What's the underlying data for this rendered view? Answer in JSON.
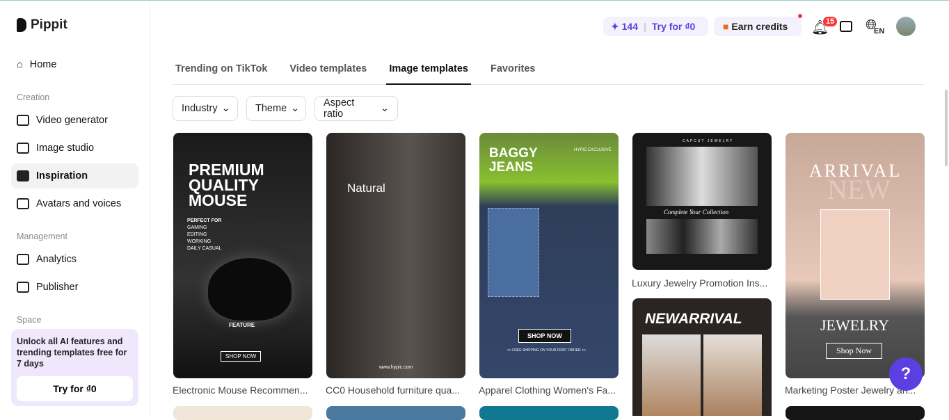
{
  "brand": "Pippit",
  "sidebar": {
    "home": "Home",
    "sections": {
      "creation": "Creation",
      "management": "Management",
      "space": "Space"
    },
    "items": [
      "Video generator",
      "Image studio",
      "Inspiration",
      "Avatars and voices",
      "Analytics",
      "Publisher"
    ],
    "promo": {
      "text": "Unlock all AI features and trending templates free for 7 days",
      "button": "Try for ₫0"
    }
  },
  "header": {
    "credits": "144",
    "try": "Try for ₫0",
    "earn": "Earn credits",
    "notifications": "15",
    "lang": "EN"
  },
  "tabs": [
    "Trending on TikTok",
    "Video templates",
    "Image templates",
    "Favorites"
  ],
  "filters": [
    "Industry",
    "Theme",
    "Aspect ratio"
  ],
  "cards": [
    {
      "title": "Electronic Mouse Recommen...",
      "poster": [
        "PREMIUM",
        "QUALITY",
        "MOUSE",
        "PERFECT FOR",
        "GAMING",
        "EDITING",
        "WORKING",
        "DAILY CASUAL",
        "FEATURE",
        "SHOP NOW"
      ]
    },
    {
      "title": "CC0 Household furniture qua...",
      "poster": [
        "Natural",
        "www.hypic.com"
      ]
    },
    {
      "title": "Apparel Clothing Women's Fa...",
      "poster": [
        "BAGGY",
        "JEANS",
        "HYPIC EXCLUSIVE",
        "SHOP NOW",
        ">> FREE SHIPPING ON YOUR FIRST ORDER <<"
      ]
    },
    {
      "title": "Luxury Jewelry Promotion Ins...",
      "poster": [
        "CAPCUT JEWELRY",
        "Complete Your Collection"
      ]
    },
    {
      "title": "",
      "poster": [
        "NEWARRIVAL"
      ]
    },
    {
      "title": "Marketing Poster Jewelry an...",
      "poster": [
        "ARRIVAL",
        "NEW",
        "JEWELRY",
        "Shop Now"
      ]
    }
  ],
  "colors": {
    "accent": "#5b3fe0",
    "promo": "#efe8fd"
  }
}
